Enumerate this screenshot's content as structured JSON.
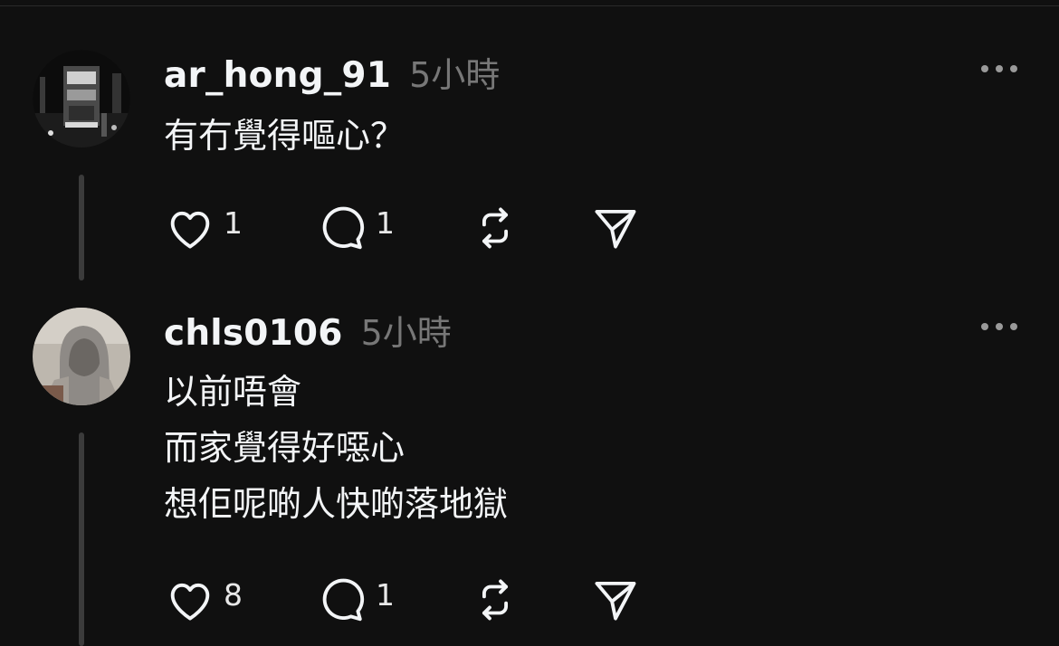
{
  "posts": [
    {
      "username": "ar_hong_91",
      "time": "5小時",
      "lines": [
        "有冇覺得嘔心？"
      ],
      "likes": "1",
      "replies": "1",
      "avatar": "night-street-tram-photo"
    },
    {
      "username": "chls0106",
      "time": "5小時",
      "lines": [
        "以前唔會",
        "而家覺得好噁心",
        "想佢呢啲人快啲落地獄"
      ],
      "likes": "8",
      "replies": "1",
      "avatar": "hooded-figure-photo"
    }
  ],
  "icons": {
    "like": "heart-icon",
    "reply": "speech-bubble-icon",
    "repost": "repost-icon",
    "share": "paper-plane-icon",
    "more": "more-dots-icon"
  },
  "colors": {
    "background": "#101010",
    "text": "#f3f5f7",
    "muted": "#777777",
    "thread_line": "#3b3b3b"
  }
}
